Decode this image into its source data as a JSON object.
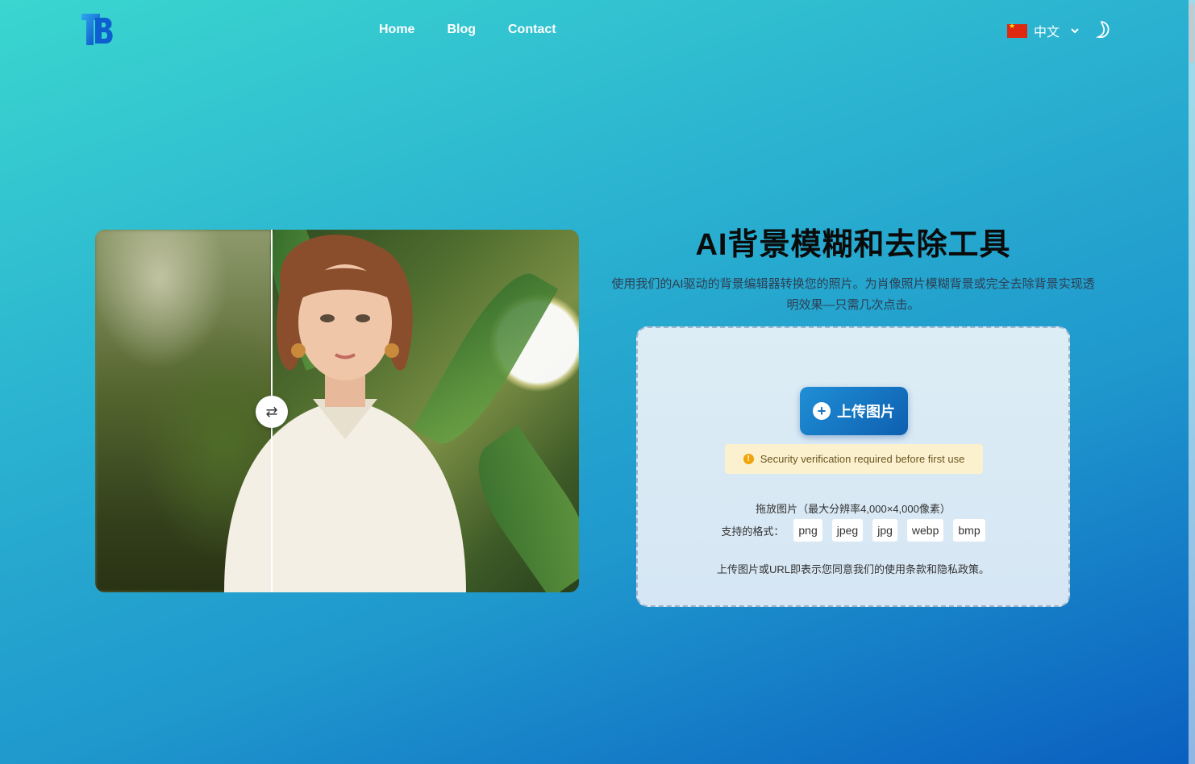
{
  "nav": {
    "items": [
      "Home",
      "Blog",
      "Contact"
    ]
  },
  "language": {
    "label": "中文"
  },
  "hero": {
    "title": "AI背景模糊和去除工具",
    "subtitle": "使用我们的AI驱动的背景编辑器转换您的照片。为肖像照片模糊背景或完全去除背景实现透明效果—只需几次点击。"
  },
  "upload": {
    "button_label": "上传图片",
    "notice": "Security verification required before first use",
    "drop_text": "拖放图片（最大分辨率4,000×4,000像素）",
    "formats_label": "支持的格式：",
    "formats": [
      "png",
      "jpeg",
      "jpg",
      "webp",
      "bmp"
    ],
    "terms": "上传图片或URL即表示您同意我们的使用条款和隐私政策。"
  },
  "icons": {
    "logo": "tb-logo",
    "flag": "china-flag-icon",
    "dropdown": "chevron-down-icon",
    "theme": "moon-icon",
    "compare_handle": "swap-arrows-icon",
    "upload": "plus-circle-icon",
    "notice": "warning-icon"
  },
  "colors": {
    "accent": "#1673c4",
    "notice_bg": "#fbf1cf"
  }
}
